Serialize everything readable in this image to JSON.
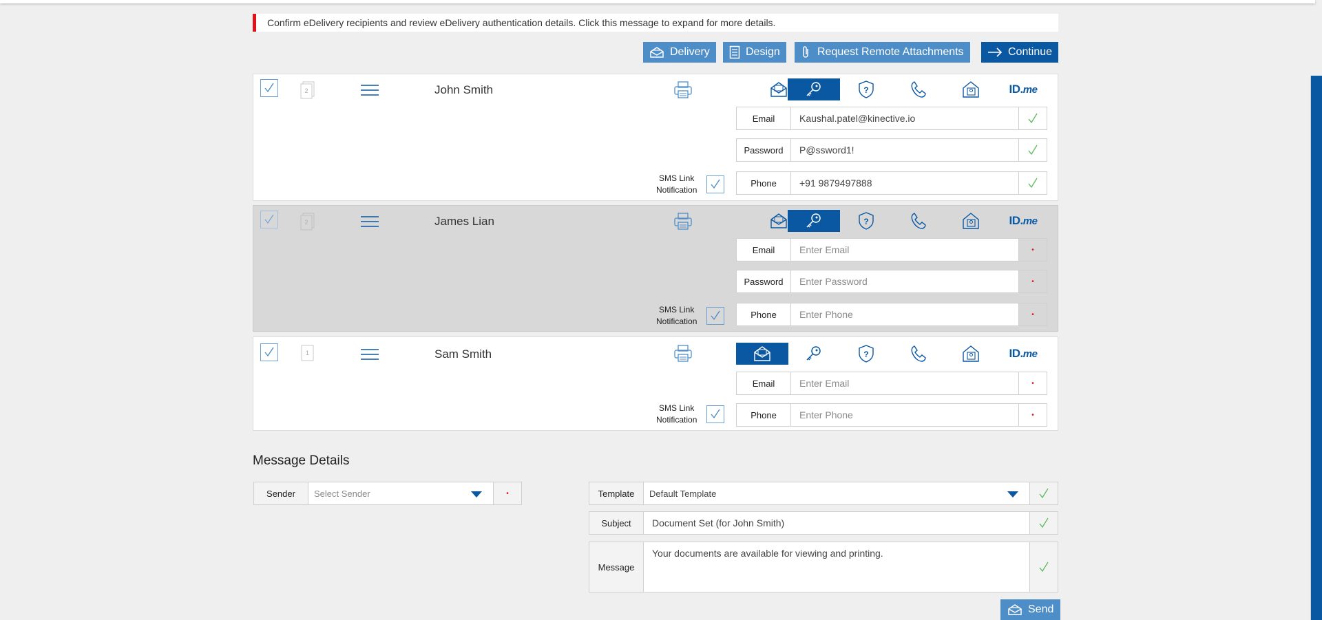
{
  "alert": {
    "text": "Confirm eDelivery recipients and review eDelivery authentication details. Click this message to expand for more details."
  },
  "toolbar": {
    "delivery_label": "Delivery",
    "design_label": "Design",
    "request_label": "Request Remote Attachments",
    "continue_label": "Continue"
  },
  "recipients": [
    {
      "name": "John Smith",
      "doc_count": "2",
      "selected_method": "password",
      "email_label": "Email",
      "email_value": "Kaushal.patel@kinective.io",
      "password_label": "Password",
      "password_value": "P@ssword1!",
      "phone_label": "Phone",
      "phone_value": "+91 9879497888",
      "sms_label_1": "SMS Link",
      "sms_label_2": "Notification"
    },
    {
      "name": "James Lian",
      "doc_count": "2",
      "selected_method": "password",
      "email_label": "Email",
      "email_placeholder": "Enter Email",
      "password_label": "Password",
      "password_placeholder": "Enter Password",
      "phone_label": "Phone",
      "phone_placeholder": "Enter Phone",
      "sms_label_1": "SMS Link",
      "sms_label_2": "Notification"
    },
    {
      "name": "Sam Smith",
      "doc_count": "1",
      "selected_method": "email",
      "email_label": "Email",
      "email_placeholder": "Enter Email",
      "phone_label": "Phone",
      "phone_placeholder": "Enter Phone",
      "sms_label_1": "SMS Link",
      "sms_label_2": "Notification"
    }
  ],
  "methods": {
    "idme_main": "ID.",
    "idme_suffix": "me"
  },
  "message_details": {
    "title": "Message Details",
    "sender_label": "Sender",
    "sender_placeholder": "Select Sender",
    "template_label": "Template",
    "template_value": "Default Template",
    "subject_label": "Subject",
    "subject_value": "Document Set (for John Smith)",
    "message_label": "Message",
    "message_value": "Your documents are available for viewing and printing.",
    "send_label": "Send"
  },
  "colors": {
    "brand_blue": "#0a57a2",
    "button_blue": "#4e8ec8",
    "alert_red": "#e0121a",
    "valid_green": "#5cb85c"
  }
}
